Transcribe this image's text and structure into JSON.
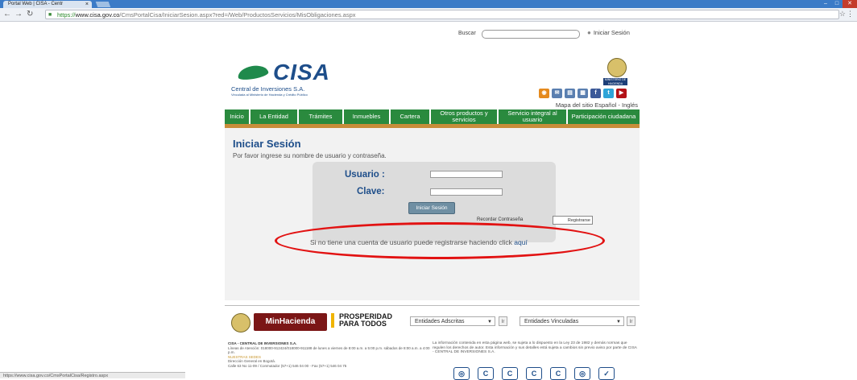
{
  "browser": {
    "tab_title": "Portal Web | CISA - Centr",
    "tab_close": "×",
    "url_https": "https://",
    "url_host": "www.cisa.gov.co",
    "url_path": "/CmsPortalCisa/IniciarSesion.aspx?red=/Web/ProductosServicios/MisObligaciones.aspx",
    "status_url": "https://www.cisa.gov.co/CmsPortalCisa/Registro.aspx"
  },
  "header": {
    "search_label": "Buscar",
    "login_link": "Iniciar Sesión",
    "logo_name": "CISA",
    "logo_subtitle": "Central de Inversiones S.A.",
    "logo_tagline": "Vinculada al Ministerio de Hacienda y Crédito Público",
    "ministry_badge": "MINISTERIO DE HACIENDA",
    "top_links": "Mapa del sitio  Español - Inglés"
  },
  "menu": [
    {
      "label": "Inicio"
    },
    {
      "label": "La Entidad"
    },
    {
      "label": "Trámites"
    },
    {
      "label": "Inmuebles"
    },
    {
      "label": "Cartera"
    },
    {
      "label": "Otros productos y servicios"
    },
    {
      "label": "Servicio integral al usuario"
    },
    {
      "label": "Participación ciudadana"
    }
  ],
  "login": {
    "title": "Iniciar Sesión",
    "subtitle": "Por favor ingrese su nombre de usuario y contraseña.",
    "user_label": "Usuario :",
    "password_label": "Clave:",
    "user_value": "",
    "password_value": "",
    "button_label": "Iniciar Sesión",
    "forgot_label": "Recordar Contraseña",
    "tooltip": "Registrarse",
    "register_text": "Si no tiene una cuenta de usuario puede registrarse haciendo click ",
    "register_link": "aquí"
  },
  "footer": {
    "minhacienda": "MinHacienda",
    "prosperidad": "PROSPERIDAD PARA TODOS",
    "select_adscritas": "Entidades Adscritas",
    "select_vinculadas": "Entidades Vinculadas",
    "go": "Ir",
    "company": "CISA - CENTRAL DE INVERSIONES S.A.",
    "lines": "Líneas de Atención: 018000-912424/018000-911188 de lunes a viernes de 8:00 a.m. a 5:00 p.m. sábados de 8:00 a.m. a 4:00 p.m.",
    "offices_link": "NUESTRAS SEDES",
    "address1": "Dirección General en Bogotá.",
    "address2": "Calle 63 No 11-09 / Conmutador (57+1) 546 04 00 - Fax (57+1) 546 04 75",
    "disclaimer": "La información contenida en esta página web, se sujeta a lo dispuesto en la Ley 23 de 1982 y demás normas que regulen los derechos de autor. Esta información y sus detalles está sujeta a cambios sin previo aviso por parte de CISA - CENTRAL DE INVERSIONES S.A."
  },
  "colors": {
    "menu_green": "#2a8a3e",
    "brand_blue": "#1e4e8a",
    "highlight_red": "#e21212"
  }
}
